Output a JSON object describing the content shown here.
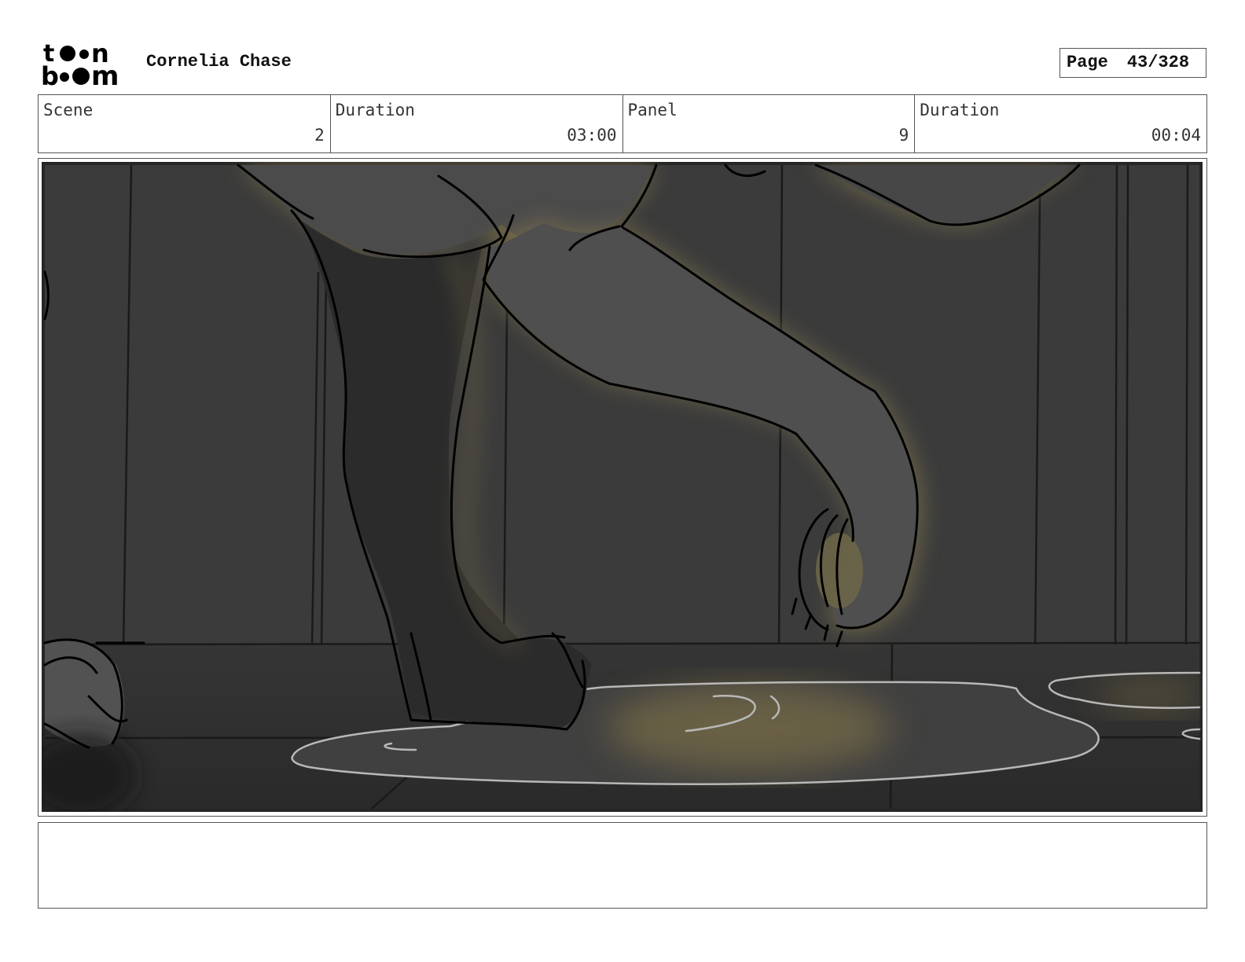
{
  "header": {
    "logo_text": "toon boom",
    "project_title": "Cornelia Chase",
    "page_label": "Page",
    "page_number": "43/328"
  },
  "info": {
    "scene_label": "Scene",
    "scene_value": "2",
    "scene_duration_label": "Duration",
    "scene_duration_value": "03:00",
    "panel_label": "Panel",
    "panel_value": "9",
    "panel_duration_label": "Duration",
    "panel_duration_value": "00:04"
  },
  "notes": {
    "text": ""
  }
}
